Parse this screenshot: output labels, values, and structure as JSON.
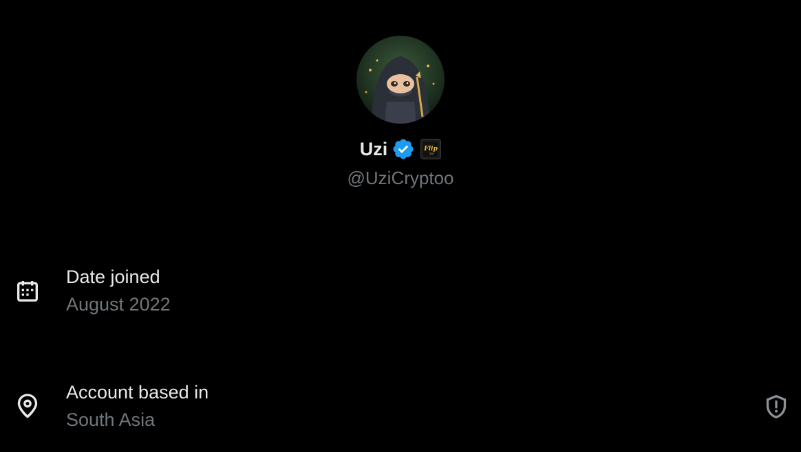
{
  "profile": {
    "display_name": "Uzi",
    "handle": "@UziCryptoo",
    "verified": true,
    "affiliate_badge_icon": "flip-affiliate-badge",
    "avatar_icon": "hooded-character-avatar"
  },
  "about": {
    "date_joined": {
      "icon": "calendar-icon",
      "label": "Date joined",
      "value": "August 2022"
    },
    "location": {
      "icon": "location-pin-icon",
      "label": "Account based in",
      "value": "South Asia",
      "action_icon": "shield-alert-icon"
    }
  },
  "colors": {
    "background": "#000000",
    "primary_text": "#e7e9ea",
    "secondary_text": "#71767b",
    "verified_blue": "#1d9bf0"
  }
}
